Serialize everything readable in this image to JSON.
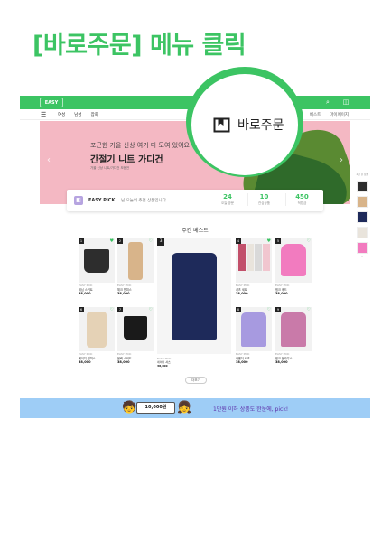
{
  "title": "[바로주문] 메뉴 클릭",
  "header": {
    "logo": "EASY PICK",
    "icons": [
      "search-icon",
      "cart-icon"
    ]
  },
  "nav": {
    "menu_icon": "☰",
    "items": [
      "여성",
      "남성",
      "잡화"
    ],
    "right": [
      "베스트",
      "마이페이지"
    ]
  },
  "banner": {
    "subtitle": "포근한 가을 신상 여기 다 모여 있어요!",
    "title": "간절기 니트 가디건",
    "desc": "가을 신상 니트/가디건 모음전"
  },
  "member": {
    "name": "EASY PICK",
    "message": "님 오늘의 추천 상품입니다.",
    "stats": [
      {
        "value": "24",
        "label": "오늘 방문"
      },
      {
        "value": "10",
        "label": "관심상품"
      },
      {
        "value": "450",
        "label": "적립금"
      }
    ]
  },
  "best": {
    "title": "주간 베스트",
    "more": "더보기",
    "products": [
      {
        "num": "1",
        "meta": "EASY PICK",
        "name": "데님 스커트",
        "price": "38,000"
      },
      {
        "num": "2",
        "meta": "EASY PICK",
        "name": "체크 원피스",
        "price": "38,000"
      },
      {
        "num": "3",
        "meta": "EASY PICK",
        "name": "네이비 셔츠",
        "price": "38,000"
      },
      {
        "num": "4",
        "meta": "EASY PICK",
        "name": "셔츠 세트",
        "price": "38,000"
      },
      {
        "num": "5",
        "meta": "EASY PICK",
        "name": "핑크 후드",
        "price": "38,000"
      },
      {
        "num": "6",
        "meta": "EASY PICK",
        "name": "베이지 원피스",
        "price": "38,000"
      },
      {
        "num": "7",
        "meta": "EASY PICK",
        "name": "블랙 스커트",
        "price": "38,000"
      },
      {
        "num": "8",
        "meta": "EASY PICK",
        "name": "라벤더 셔츠",
        "price": "38,000"
      },
      {
        "num": "9",
        "meta": "EASY PICK",
        "name": "핑크 블라우스",
        "price": "38,000"
      }
    ]
  },
  "side": {
    "label": "최근 본 상품"
  },
  "popup": {
    "icon": "bookmark-icon",
    "label": "바로주문"
  },
  "footer_banner": {
    "bubble": "10,000원",
    "text": "1만원 이하 상품도 한눈에, pick!"
  },
  "colors": {
    "accent": "#3cc463",
    "banner_bg": "#f4b8c3",
    "footer_bg": "#9ecdf6",
    "footer_text": "#5b2ca8"
  }
}
